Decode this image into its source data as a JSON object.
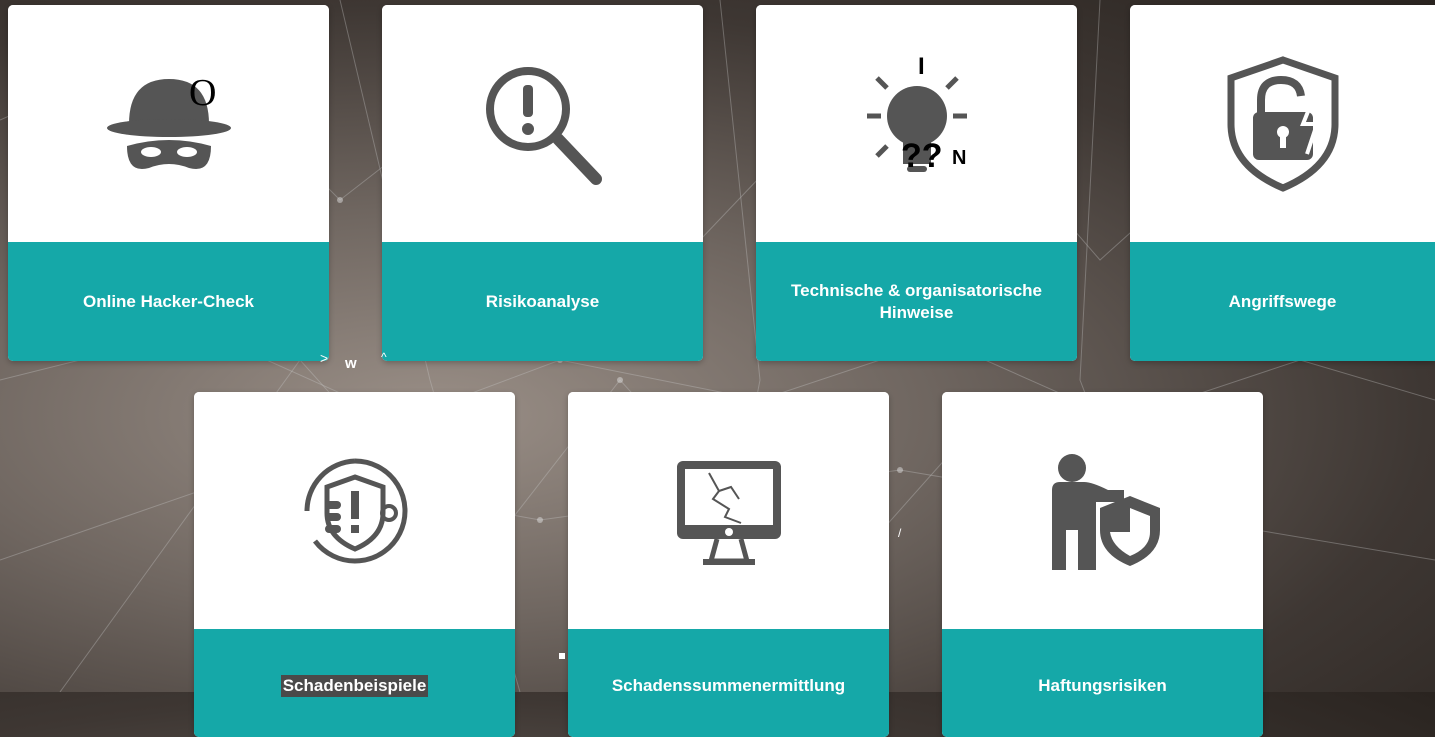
{
  "cards_row1": [
    {
      "label": "Online Hacker-Check",
      "icon": "spy-icon",
      "overlay": "O"
    },
    {
      "label": "Risikoanalyse",
      "icon": "magnifier-alert-icon"
    },
    {
      "label": "Technische & organisatorische Hinweise",
      "icon": "lightbulb-icon",
      "overlay_top": "I",
      "overlay_q": "??",
      "overlay_n": "N"
    },
    {
      "label": "Angriffswege",
      "icon": "shield-lock-icon"
    }
  ],
  "cards_row2": [
    {
      "label": "Schadenbeispiele",
      "icon": "hand-shield-icon"
    },
    {
      "label": "Schadenssummenermittlung",
      "icon": "broken-monitor-icon"
    },
    {
      "label": "Haftungsrisiken",
      "icon": "person-shield-icon"
    }
  ],
  "stray": {
    "w": "w",
    "gt": ">",
    "caret": "^",
    "slash": "/"
  },
  "colors": {
    "accent": "#15a8a8",
    "icon": "#555555",
    "card": "#ffffff"
  }
}
